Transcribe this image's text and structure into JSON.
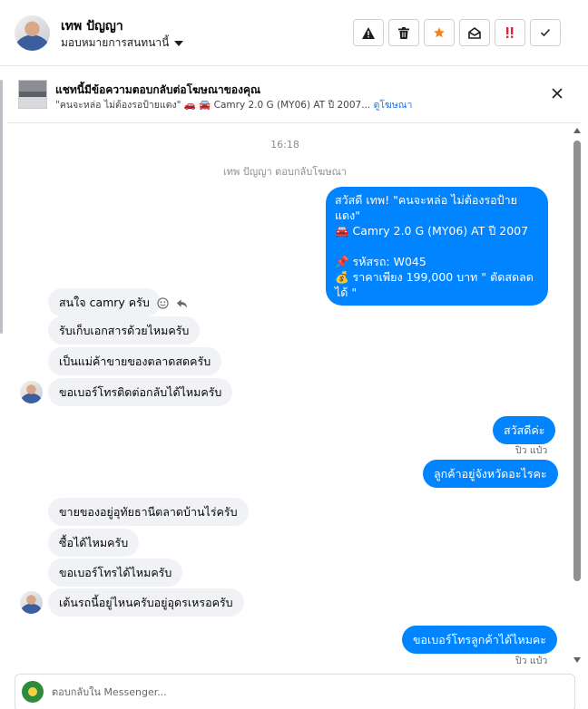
{
  "header": {
    "user_name": "เทพ ปัญญา",
    "assign_label": "มอบหมายการสนทนานี้",
    "actions": [
      {
        "name": "report",
        "icon": "warning-icon"
      },
      {
        "name": "delete",
        "icon": "trash-icon"
      },
      {
        "name": "star",
        "icon": "star-icon",
        "color": "#f5821f"
      },
      {
        "name": "mark-unread",
        "icon": "envelope-open-icon"
      },
      {
        "name": "priority",
        "icon": "priority-icon",
        "color": "#e41e3f"
      },
      {
        "name": "done",
        "icon": "check-icon"
      }
    ]
  },
  "ad_banner": {
    "title": "แชทนี้มีข้อความตอบกลับต่อโฆษณาของคุณ",
    "subtitle": "\"คนจะหล่อ ไม่ต้องรอป้ายแดง\" 🚗 🚘 Camry 2.0 G (MY06) AT ปี 2007...",
    "link": "ดูโฆษณา"
  },
  "conversation": {
    "timestamp": "16:18",
    "replied_note": "เทพ ปัญญา ตอบกลับโฆษณา",
    "messages": [
      {
        "side": "out",
        "text": "สวัสดี เทพ! \"คนจะหล่อ ไม่ต้องรอป้ายแดง\"\n🚘 Camry 2.0 G (MY06) AT ปี 2007\n\n📌 รหัสรถ: W045\n💰 ราคาเพียง 199,000 บาท \" ตัดสดลดได้ \""
      },
      {
        "side": "in",
        "text": "สนใจ camry ครับ"
      },
      {
        "side": "in",
        "text": "รับเก็บเอกสารด้วยไหมครับ"
      },
      {
        "side": "in",
        "text": "เป็นแม่ค้าขายของตลาดสดครับ"
      },
      {
        "side": "in",
        "text": "ขอเบอร์โทรติดต่อกลับได้ไหมครับ"
      },
      {
        "side": "out",
        "text": "สวัสดีค่ะ"
      },
      {
        "side": "out",
        "text": "ลูกค้าอยู่จังหวัดอะไรคะ"
      },
      {
        "side": "in",
        "text": "ขายของอยู่อุทัยธานีตลาดบ้านไร่ครับ"
      },
      {
        "side": "in",
        "text": "ซื้อได้ไหมครับ"
      },
      {
        "side": "in",
        "text": "ขอเบอร์โทรได้ไหมครับ"
      },
      {
        "side": "in",
        "text": "เต้นรถนี้อยู่ไหนครับอยู่อุดรเหรอครับ"
      },
      {
        "side": "out",
        "text": "ขอเบอร์โทรลูกค้าได้ไหมคะ"
      }
    ],
    "seen_by_1": "ปิว แป๋ว",
    "seen_by_2": "ปิว แป๋ว"
  },
  "composer": {
    "placeholder": "ตอบกลับใน Messenger..."
  }
}
